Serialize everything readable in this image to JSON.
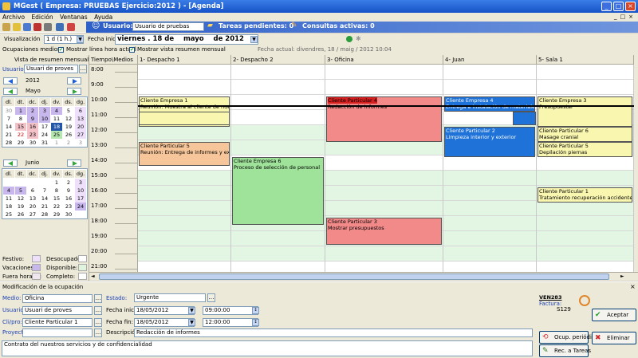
{
  "window": {
    "title": "MGest ( Empresa: PRUEBAS Ejercicio:2012 ) - [Agenda]"
  },
  "menu": [
    "Archivo",
    "Edición",
    "Ventanas",
    "Ayuda"
  ],
  "toolbar": {
    "usuario_label": "Usuario:",
    "usuario_value": "Usuario de pruebas",
    "tareas": "Tareas pendientes: 0",
    "consultas": "Consultas activas: 0"
  },
  "viz": {
    "label": "Visualización",
    "value": "1 d (1 h.)",
    "fecha_label": "Fecha inicio",
    "fecha_day": "viernes",
    "fecha_sep": ". 18 de",
    "fecha_month": "mayo",
    "fecha_year": "de 2012"
  },
  "occ": {
    "label": "Ocupaciones medios",
    "chk1": "Mostrar línea hora actual",
    "chk2": "Mostrar vista resumen mensual",
    "fecha_actual": "Fecha actual: divendres, 18 / maig / 2012 10:04"
  },
  "left": {
    "vista": "Vista de resumen mensual",
    "usuario_label": "Usuario:",
    "usuario_value": "Usuari de proves",
    "year": "2012",
    "month1": "Mayo",
    "month2": "Junio",
    "weekdays": [
      "dl.",
      "dt.",
      "dc.",
      "dj.",
      "dv.",
      "ds.",
      "dg."
    ],
    "may": [
      [
        "30",
        "1",
        "2",
        "3",
        "4",
        "5",
        "6"
      ],
      [
        "7",
        "8",
        "9",
        "10",
        "11",
        "12",
        "13"
      ],
      [
        "14",
        "15",
        "16",
        "17",
        "18",
        "19",
        "20"
      ],
      [
        "21",
        "22",
        "23",
        "24",
        "25",
        "26",
        "27"
      ],
      [
        "28",
        "29",
        "30",
        "31",
        "1",
        "2",
        "3"
      ]
    ],
    "june": [
      [
        "",
        "",
        "",
        "",
        "1",
        "2",
        "3"
      ],
      [
        "4",
        "5",
        "6",
        "7",
        "8",
        "9",
        "10"
      ],
      [
        "11",
        "12",
        "13",
        "14",
        "15",
        "16",
        "17"
      ],
      [
        "18",
        "19",
        "20",
        "21",
        "22",
        "23",
        "24"
      ],
      [
        "25",
        "26",
        "27",
        "28",
        "29",
        "30",
        ""
      ]
    ],
    "legend": {
      "festivo": "Festivo:",
      "desocupado": "Desocupado:",
      "vacaciones": "Vacaciones:",
      "disponible": "Disponible:",
      "fuera": "Fuera horario:",
      "completo": "Completo:"
    }
  },
  "grid": {
    "time_header": "Tiempo\\Medios",
    "columns": [
      "1- Despacho 1",
      "2- Despacho 2",
      "3- Oficina",
      "4- Juan",
      "5- Sala 1"
    ],
    "hours": [
      "8:00",
      "9:00",
      "10:00",
      "11:00",
      "12:00",
      "13:00",
      "14:00",
      "15:00",
      "16:00",
      "17:00",
      "18:00",
      "19:00",
      "20:00",
      "21:00"
    ],
    "events": [
      {
        "col": 0,
        "t1": "Cliente Empresa 1",
        "t2": "Reunión: Muestra al cliente de nuestros se"
      },
      {
        "col": 2,
        "t1": "Cliente Particular 4",
        "t2": "Redacción de informes"
      },
      {
        "col": 3,
        "t1": "Cliente Empresa 4",
        "t2": "Entrega e instalación de materiales"
      },
      {
        "col": 4,
        "t1": "Cliente Empresa 3",
        "t2": "Presupuestar"
      },
      {
        "col": 3,
        "t1": "Cliente Particular 2",
        "t2": "Limpieza interior y exterior"
      },
      {
        "col": 4,
        "t1": "Cliente Particular 6",
        "t2": "Masage cranial"
      },
      {
        "col": 4,
        "t1": "Cliente Particular 5",
        "t2": "Depilación piernas"
      },
      {
        "col": 0,
        "t1": "Cliente Particular 5",
        "t2": "Reunión: Entrega de informes y explicació"
      },
      {
        "col": 1,
        "t1": "Cliente Empresa 6",
        "t2": "Proceso de selección de personal"
      },
      {
        "col": 4,
        "t1": "Cliente Particular 1",
        "t2": "Tratamiento recuperación accidente"
      },
      {
        "col": 2,
        "t1": "Cliente Particular 3",
        "t2": "Mostrar presupuestos"
      }
    ]
  },
  "form": {
    "title": "Modificación de la ocupación",
    "medio_label": "Medio:",
    "medio": "Oficina",
    "usuario_label": "Usuario:",
    "usuario": "Usuari de proves",
    "cli_label": "Cli/pro:",
    "cli": "Cliente Particular 1",
    "proyecto_label": "Proyecto:",
    "estado_label": "Estado:",
    "estado": "Urgente",
    "fi_label": "Fecha inicio:",
    "fi": "18/05/2012",
    "hi": "09:00:00",
    "ff_label": "Fecha fin:",
    "ff": "18/05/2012",
    "hf": "12:00:00",
    "desc_label": "Descripción:",
    "desc": "Redacción de informes",
    "notes": "Contrato del nuestros servicios y de confidencialidad",
    "doc_code": "VEN283",
    "factura_label": "Factura:",
    "factura": "S129",
    "aceptar": "Aceptar",
    "eliminar": "Eliminar",
    "ocup": "Ocup. periódica",
    "rec": "Rec. a Tareas"
  }
}
